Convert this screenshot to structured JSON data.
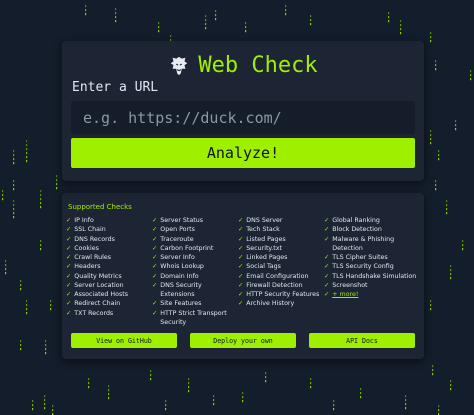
{
  "app": {
    "title": "Web Check",
    "logo_icon": "lion-icon"
  },
  "colors": {
    "background": "#141d2b",
    "card": "#1d2534",
    "accent": "#9fef00",
    "input_bg": "#151d2a"
  },
  "search": {
    "label": "Enter a URL",
    "placeholder": "e.g. https://duck.com/",
    "value": "",
    "submit_label": "Analyze!"
  },
  "checks": {
    "heading": "Supported Checks",
    "tick": "✓",
    "columns": [
      [
        "IP Info",
        "SSL Chain",
        "DNS Records",
        "Cookies",
        "Crawl Rules",
        "Headers",
        "Quality Metrics",
        "Server Location",
        "Associated Hosts",
        "Redirect Chain",
        "TXT Records"
      ],
      [
        "Server Status",
        "Open Ports",
        "Traceroute",
        "Carbon Footprint",
        "Server Info",
        "Whois Lookup",
        "Domain Info",
        "DNS Security Extensions",
        "Site Features",
        "HTTP Strict Transport Security"
      ],
      [
        "DNS Server",
        "Tech Stack",
        "Listed Pages",
        "Security.txt",
        "Linked Pages",
        "Social Tags",
        "Email Configuration",
        "Firewall Detection",
        "HTTP Security Features",
        "Archive History"
      ],
      [
        "Global Ranking",
        "Block Detection",
        "Malware & Phishing Detection",
        "TLS Cipher Suites",
        "TLS Security Config",
        "TLS Handshake Simulation",
        "Screenshot",
        "+ more!"
      ]
    ]
  },
  "links": {
    "github": "View on GitHub",
    "deploy": "Deploy your own",
    "api": "API Docs"
  }
}
